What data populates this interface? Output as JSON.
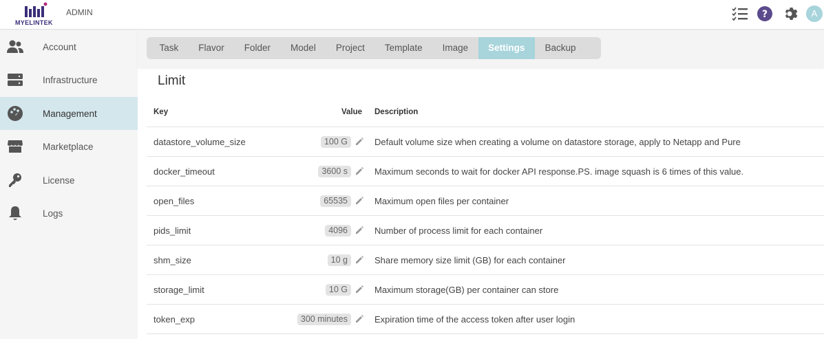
{
  "brand": {
    "logo_text": "MYELINTEK",
    "role": "ADMIN",
    "logo_color": "#3a2e7a",
    "logo_accent": "#b02c7a"
  },
  "header_icons": [
    "checklist-icon",
    "help-icon",
    "gear-icon",
    "avatar"
  ],
  "user": {
    "avatar_letter": "A",
    "avatar_color": "#a8d4dc"
  },
  "sidebar": {
    "items": [
      {
        "label": "Account",
        "icon": "users-icon",
        "active": false
      },
      {
        "label": "Infrastructure",
        "icon": "server-icon",
        "active": false
      },
      {
        "label": "Management",
        "icon": "palette-icon",
        "active": true
      },
      {
        "label": "Marketplace",
        "icon": "store-icon",
        "active": false
      },
      {
        "label": "License",
        "icon": "key-icon",
        "active": false
      },
      {
        "label": "Logs",
        "icon": "bell-icon",
        "active": false
      }
    ]
  },
  "tabs": [
    {
      "label": "Task",
      "active": false
    },
    {
      "label": "Flavor",
      "active": false
    },
    {
      "label": "Folder",
      "active": false
    },
    {
      "label": "Model",
      "active": false
    },
    {
      "label": "Project",
      "active": false
    },
    {
      "label": "Template",
      "active": false
    },
    {
      "label": "Image",
      "active": false
    },
    {
      "label": "Settings",
      "active": true
    },
    {
      "label": "Backup",
      "active": false
    }
  ],
  "section": {
    "title": "Limit"
  },
  "table": {
    "headers": {
      "key": "Key",
      "value": "Value",
      "description": "Description"
    },
    "rows": [
      {
        "key": "datastore_volume_size",
        "value": "100 G",
        "description": "Default volume size when creating a volume on datastore storage, apply to Netapp and Pure"
      },
      {
        "key": "docker_timeout",
        "value": "3600 s",
        "description": "Maximum seconds to wait for docker API response.PS. image squash is 6 times of this value."
      },
      {
        "key": "open_files",
        "value": "65535",
        "description": "Maximum open files per container"
      },
      {
        "key": "pids_limit",
        "value": "4096",
        "description": "Number of process limit for each container"
      },
      {
        "key": "shm_size",
        "value": "10 g",
        "description": "Share memory size limit (GB) for each container"
      },
      {
        "key": "storage_limit",
        "value": "10 G",
        "description": "Maximum storage(GB) per container can store"
      },
      {
        "key": "token_exp",
        "value": "300 minutes",
        "description": "Expiration time of the access token after user login"
      }
    ]
  },
  "colors": {
    "active_tab": "#a8d4dc",
    "active_nav": "#d4e7ec",
    "icon_gray": "#555555",
    "help_purple": "#5b4a8c"
  }
}
